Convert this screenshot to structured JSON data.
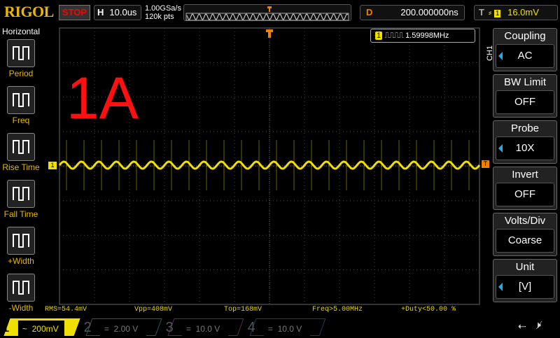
{
  "header": {
    "logo": "RIGOL",
    "run_state": "STOP",
    "h_label": "H",
    "timebase": "10.0us",
    "sample_rate": "1.00GSa/s",
    "memory_depth": "120k pts",
    "delay_label": "D",
    "delay": "200.000000ns",
    "trigger_label": "T",
    "trigger_channel": "1",
    "trigger_level": "16.0mV"
  },
  "left_menu": {
    "title": "Horizontal",
    "items": [
      {
        "label": "Period",
        "icon": "period-icon"
      },
      {
        "label": "Freq",
        "icon": "freq-icon"
      },
      {
        "label": "Rise Time",
        "icon": "rise-time-icon"
      },
      {
        "label": "Fall Time",
        "icon": "fall-time-icon"
      },
      {
        "label": "+Width",
        "icon": "pos-width-icon"
      },
      {
        "label": "-Width",
        "icon": "neg-width-icon"
      }
    ]
  },
  "right_menu": {
    "channel": "CH1",
    "items": [
      {
        "title": "Coupling",
        "value": "AC"
      },
      {
        "title": "BW Limit",
        "value": "OFF"
      },
      {
        "title": "Probe",
        "value": "10X"
      },
      {
        "title": "Invert",
        "value": "OFF"
      },
      {
        "title": "Volts/Div",
        "value": "Coarse"
      },
      {
        "title": "Unit",
        "value": "[V]"
      }
    ]
  },
  "screen": {
    "annotation": "1A",
    "freq_badge_channel": "1",
    "freq_counter": "1.59998MHz",
    "ch1_marker": "1",
    "trigger_marker": "T"
  },
  "measurements": [
    "RMS=54.4mV",
    "Vpp=408mV",
    "Top=168mV",
    "Freq>5.00MHz",
    "+Duty<50.00 %"
  ],
  "channels": [
    {
      "num": "1",
      "coupling": "~",
      "scale": "200mV",
      "color": "#f0e000"
    },
    {
      "num": "2",
      "coupling": "=",
      "scale": "2.00 V",
      "color": "#1e5f5a"
    },
    {
      "num": "3",
      "coupling": "=",
      "scale": "10.0 V",
      "color": "#5a2a5a"
    },
    {
      "num": "4",
      "coupling": "=",
      "scale": "10.0 V",
      "color": "#1e3a5f"
    }
  ],
  "colors": {
    "trace": "#f0e000",
    "accent": "#e8b800",
    "trigger": "#f08000"
  }
}
